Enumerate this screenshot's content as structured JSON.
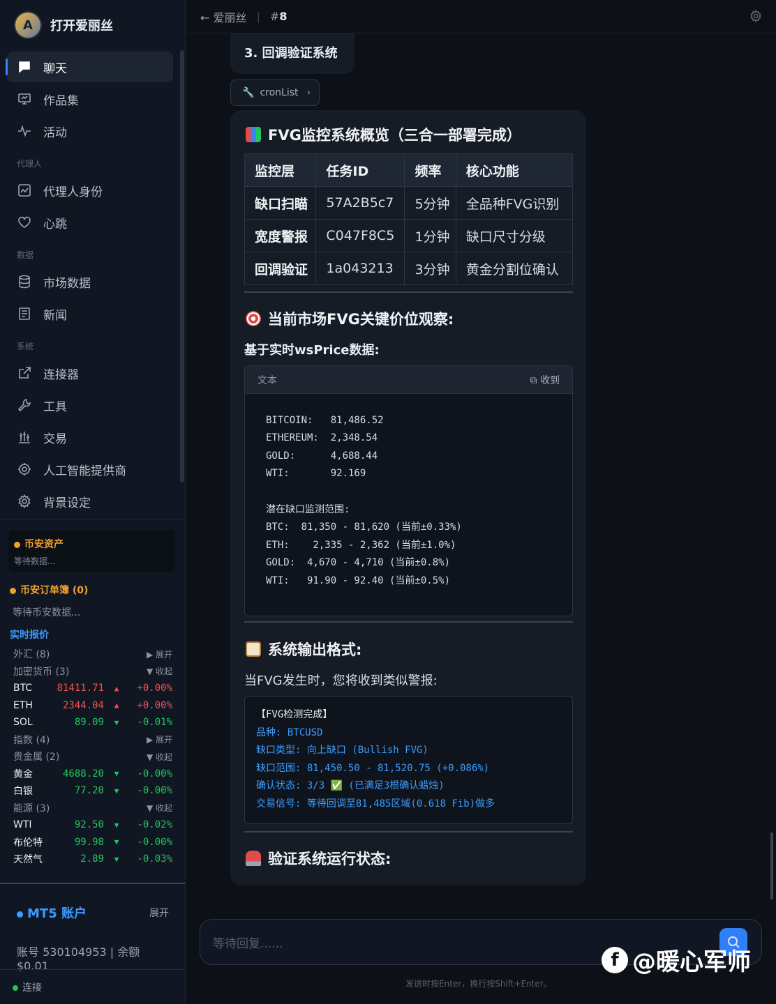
{
  "brand": {
    "name": "打开爱丽丝",
    "logo_text": "A"
  },
  "nav": {
    "items": [
      {
        "label": "聊天"
      },
      {
        "label": "作品集"
      },
      {
        "label": "活动"
      },
      {
        "label": "代理人身份"
      },
      {
        "label": "心跳"
      },
      {
        "label": "市场数据"
      },
      {
        "label": "新闻"
      },
      {
        "label": "连接器"
      },
      {
        "label": "工具"
      },
      {
        "label": "交易"
      },
      {
        "label": "人工智能提供商"
      },
      {
        "label": "背景设定"
      }
    ],
    "sections": [
      "代理人",
      "数据",
      "系统"
    ]
  },
  "binance": {
    "assets_title": "币安资产",
    "assets_status": "等待数据...",
    "orders_title": "币安订单簿 (0)",
    "orders_status": "等待币安数据..."
  },
  "quotes": {
    "title": "实时报价",
    "forex": {
      "label": "外汇 (8)",
      "toggle": "▶ 展开"
    },
    "crypto": {
      "label": "加密货币 (3)",
      "toggle": "▼ 收起"
    },
    "crypto_rows": [
      {
        "sym": "BTC",
        "px": "81411.71",
        "arr": "▲",
        "chg": "+0.00%"
      },
      {
        "sym": "ETH",
        "px": "2344.04",
        "arr": "▲",
        "chg": "+0.00%"
      },
      {
        "sym": "SOL",
        "px": "89.09",
        "arr": "▼",
        "chg": "-0.01%"
      }
    ],
    "index": {
      "label": "指数 (4)",
      "toggle": "▶ 展开"
    },
    "metals": {
      "label": "贵金属 (2)",
      "toggle": "▼ 收起"
    },
    "metal_rows": [
      {
        "sym": "黄金",
        "px": "4688.20",
        "arr": "▼",
        "chg": "-0.00%"
      },
      {
        "sym": "白银",
        "px": "77.20",
        "arr": "▼",
        "chg": "-0.00%"
      }
    ],
    "energy": {
      "label": "能源 (3)",
      "toggle": "▼ 收起"
    },
    "energy_rows": [
      {
        "sym": "WTI",
        "px": "92.50",
        "arr": "▼",
        "chg": "-0.02%"
      },
      {
        "sym": "布伦特",
        "px": "99.98",
        "arr": "▼",
        "chg": "-0.00%"
      },
      {
        "sym": "天然气",
        "px": "2.89",
        "arr": "▼",
        "chg": "-0.03%"
      }
    ]
  },
  "mt5": {
    "title": "MT5 账户",
    "expand": "展开",
    "account": "账号 530104953 | 余额 $0.01"
  },
  "connection": {
    "label": "连接"
  },
  "header": {
    "back": "爱丽丝",
    "sep": "|",
    "hash": "#",
    "num": "8"
  },
  "chat": {
    "prev_item": "3. 回调验证系统",
    "tool_chip": "cronList",
    "overview_title": "FVG监控系统概览（三合一部署完成）",
    "table": {
      "headers": [
        "监控层",
        "任务ID",
        "频率",
        "核心功能"
      ],
      "rows": [
        [
          "缺口扫瞄",
          "57A2B5c7",
          "5分钟",
          "全品种FVG识别"
        ],
        [
          "宽度警报",
          "C047F8C5",
          "1分钟",
          "缺口尺寸分级"
        ],
        [
          "回调验证",
          "1a043213",
          "3分钟",
          "黄金分割位确认"
        ]
      ]
    },
    "levels_title": "当前市场FVG关键价位观察:",
    "levels_sub": "基于实时wsPrice数据:",
    "code_label": "文本",
    "code_action": "收到",
    "code_text": "\nBITCOIN:   81,486.52\nETHEREUM:  2,348.54\nGOLD:      4,688.44\nWTI:       92.169\n\n潜在缺口监测范围:\nBTC:  81,350 - 81,620 (当前±0.33%)\nETH:    2,335 - 2,362 (当前±1.0%)\nGOLD:  4,670 - 4,710 (当前±0.8%)\nWTI:   91.90 - 92.40 (当前±0.5%)",
    "format_title": "系统输出格式:",
    "format_sub": "当FVG发生时，您将收到类似警报:",
    "alert_head": "【FVG检测完成】",
    "alert_lines": [
      "品种: BTCUSD",
      "缺口类型: 向上缺口 (Bullish FVG)",
      "缺口范围: 81,450.50 - 81,520.75 (+0.086%)",
      "确认状态: 3/3 ✅ (已满足3根确认蜡烛)",
      "交易信号: 等待回调至81,485区域(0.618 Fib)做多"
    ],
    "status_title": "验证系统运行状态:"
  },
  "input": {
    "placeholder": "等待回复......",
    "hint": "发送时按Enter，换行按Shift+Enter。"
  },
  "watermark": {
    "text": "@暖心军师"
  },
  "colors": {
    "accent": "#3b82f6",
    "up": "#f05252",
    "down": "#22c55e",
    "orange": "#f0a030"
  }
}
